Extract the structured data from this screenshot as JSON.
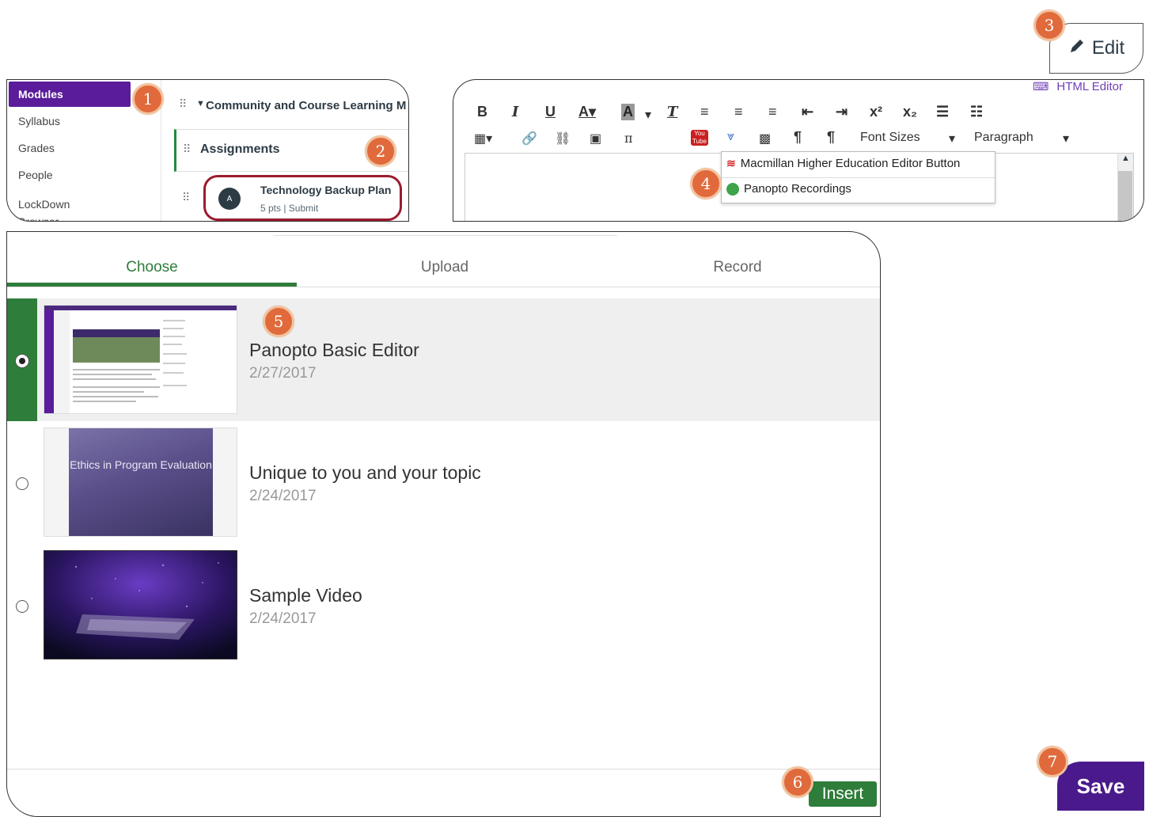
{
  "steps": [
    "1",
    "2",
    "3",
    "4",
    "5",
    "6",
    "7"
  ],
  "course_nav": {
    "active": "Modules",
    "items": [
      "Syllabus",
      "Grades",
      "People",
      "LockDown Browser"
    ]
  },
  "modules": {
    "module_title": "Community and Course Learning M",
    "assignments_label": "Assignments",
    "item": {
      "title": "Technology Backup Plan",
      "meta": "5 pts  |  Submit"
    }
  },
  "edit_button": {
    "label": "Edit"
  },
  "editor": {
    "html_editor_label": "HTML Editor",
    "font_sizes_label": "Font Sizes",
    "paragraph_label": "Paragraph",
    "dropdown_items": [
      "Macmillan Higher Education Editor Button",
      "Panopto Recordings"
    ]
  },
  "chooser": {
    "tabs": [
      "Choose",
      "Upload",
      "Record"
    ],
    "active_tab": "Choose",
    "videos": [
      {
        "title": "Panopto Basic Editor",
        "date": "2/27/2017",
        "selected": true,
        "thumb_text": ""
      },
      {
        "title": "Unique to you and your topic",
        "date": "2/24/2017",
        "selected": false,
        "thumb_text": "Ethics in Program Evaluation"
      },
      {
        "title": "Sample Video",
        "date": "2/24/2017",
        "selected": false,
        "thumb_text": ""
      }
    ],
    "insert_label": "Insert"
  },
  "save_button": {
    "label": "Save"
  },
  "colors": {
    "accent_purple": "#5a1c9b",
    "panopto_green": "#2e7d3a",
    "badge_orange": "#e06a3c",
    "danger_red": "#9b1b2e"
  }
}
